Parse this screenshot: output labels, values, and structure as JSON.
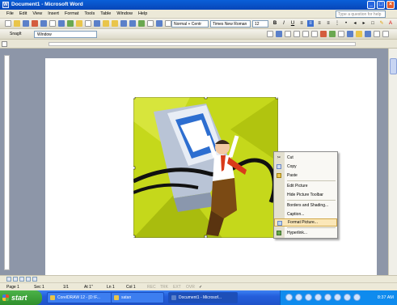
{
  "window": {
    "title": "Document1 - Microsoft Word"
  },
  "menu": [
    "File",
    "Edit",
    "View",
    "Insert",
    "Format",
    "Tools",
    "Table",
    "Window",
    "Help"
  ],
  "help_placeholder": "Type a question for help",
  "formatting": {
    "style": "Normal + Centr",
    "font": "Times New Roman",
    "size": "12",
    "bold": "B",
    "italic": "I",
    "underline": "U"
  },
  "snagit": {
    "label": "SnagIt",
    "window_combo": "Window"
  },
  "context_menu": {
    "items": [
      {
        "label": "Cut",
        "icon": "scissors-icon"
      },
      {
        "label": "Copy",
        "icon": "copy-icon"
      },
      {
        "label": "Paste",
        "icon": "paste-icon"
      },
      {
        "label": "Edit Picture",
        "icon": ""
      },
      {
        "label": "Hide Picture Toolbar",
        "icon": ""
      },
      {
        "label": "Borders and Shading...",
        "icon": ""
      },
      {
        "label": "Caption...",
        "icon": ""
      },
      {
        "label": "Format Picture...",
        "icon": "format-picture-icon",
        "highlighted": true
      },
      {
        "label": "Hyperlink...",
        "icon": "hyperlink-icon"
      }
    ]
  },
  "status": {
    "page": "Page 1",
    "sec": "Sec 1",
    "pages": "1/1",
    "at": "At 1\"",
    "ln": "Ln 1",
    "col": "Col 1",
    "rec": "REC",
    "trk": "TRK",
    "ext": "EXT",
    "ovr": "OVR"
  },
  "taskbar": {
    "start": "start",
    "items": [
      "CorelDRAW 12 - [D:\\F...",
      "satan",
      "Document1 - Microsof..."
    ],
    "clock": "8:37 AM"
  }
}
